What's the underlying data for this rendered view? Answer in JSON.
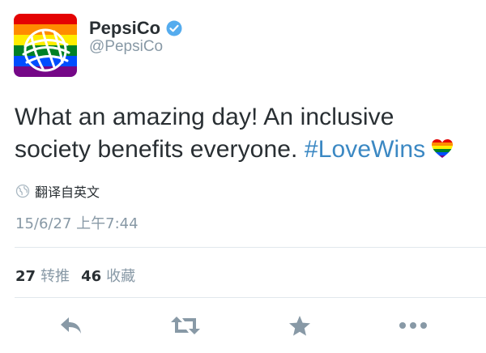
{
  "user": {
    "display_name": "PepsiCo",
    "handle": "@PepsiCo",
    "avatar_icon": "pepsico-rainbow-globe-logo",
    "verified_icon": "verified-badge-icon"
  },
  "tweet": {
    "text_part1": "What an amazing day! An inclusive society benefits everyone. ",
    "hashtag": "#LoveWins",
    "emoji_icon": "rainbow-heart-icon",
    "translate_icon": "globe-icon",
    "translate_label": "翻译自英文",
    "timestamp": "15/6/27 上午7:44"
  },
  "stats": {
    "retweets_count": "27",
    "retweets_label": "转推",
    "favorites_count": "46",
    "favorites_label": "收藏"
  },
  "actions": [
    {
      "icon": "reply-icon"
    },
    {
      "icon": "retweet-icon"
    },
    {
      "icon": "favorite-star-icon"
    },
    {
      "icon": "more-icon"
    }
  ],
  "colors": {
    "text": "#292f33",
    "secondary": "#8899a6",
    "link": "#3b88c3",
    "verified": "#55acee",
    "icon": "#8899a6"
  }
}
